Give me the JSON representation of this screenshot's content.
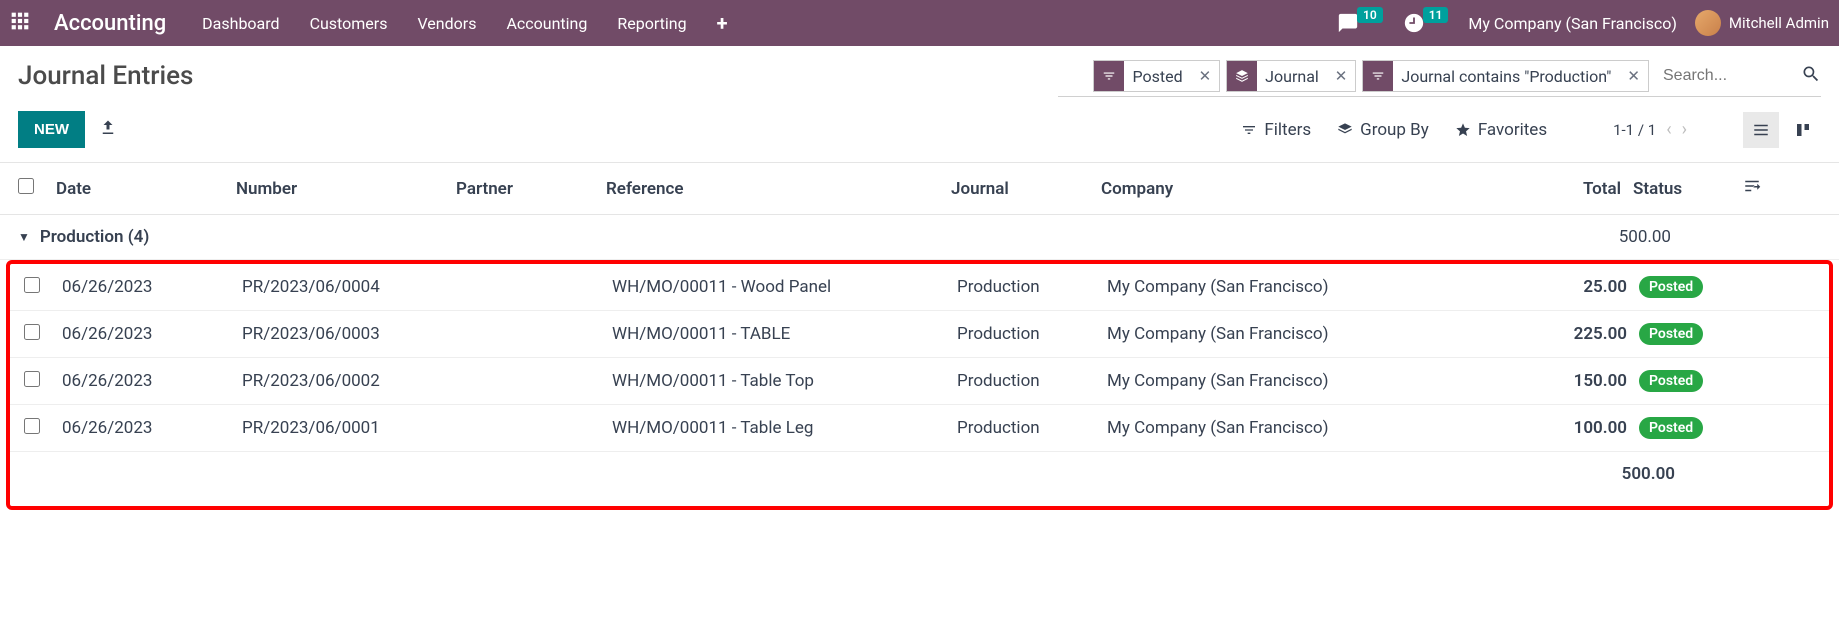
{
  "nav": {
    "brand": "Accounting",
    "menu": [
      "Dashboard",
      "Customers",
      "Vendors",
      "Accounting",
      "Reporting"
    ],
    "messages_badge": "10",
    "activities_badge": "11",
    "company": "My Company (San Francisco)",
    "user": "Mitchell Admin"
  },
  "page": {
    "title": "Journal Entries",
    "new_button": "NEW"
  },
  "search": {
    "facets": [
      {
        "icon": "filter",
        "label": "Posted"
      },
      {
        "icon": "layers",
        "label": "Journal"
      },
      {
        "icon": "filter",
        "label": "Journal contains \"Production\""
      }
    ],
    "placeholder": "Search..."
  },
  "toolbar": {
    "filters": "Filters",
    "groupby": "Group By",
    "favorites": "Favorites",
    "pager": "1-1 / 1"
  },
  "columns": {
    "date": "Date",
    "number": "Number",
    "partner": "Partner",
    "reference": "Reference",
    "journal": "Journal",
    "company": "Company",
    "total": "Total",
    "status": "Status"
  },
  "group": {
    "label": "Production (4)",
    "total": "500.00"
  },
  "rows": [
    {
      "date": "06/26/2023",
      "number": "PR/2023/06/0004",
      "partner": "",
      "reference": "WH/MO/00011 - Wood Panel",
      "journal": "Production",
      "company": "My Company (San Francisco)",
      "total": "25.00",
      "status": "Posted"
    },
    {
      "date": "06/26/2023",
      "number": "PR/2023/06/0003",
      "partner": "",
      "reference": "WH/MO/00011 - TABLE",
      "journal": "Production",
      "company": "My Company (San Francisco)",
      "total": "225.00",
      "status": "Posted"
    },
    {
      "date": "06/26/2023",
      "number": "PR/2023/06/0002",
      "partner": "",
      "reference": "WH/MO/00011 - Table Top",
      "journal": "Production",
      "company": "My Company (San Francisco)",
      "total": "150.00",
      "status": "Posted"
    },
    {
      "date": "06/26/2023",
      "number": "PR/2023/06/0001",
      "partner": "",
      "reference": "WH/MO/00011 - Table Leg",
      "journal": "Production",
      "company": "My Company (San Francisco)",
      "total": "100.00",
      "status": "Posted"
    }
  ],
  "footer_total": "500.00"
}
